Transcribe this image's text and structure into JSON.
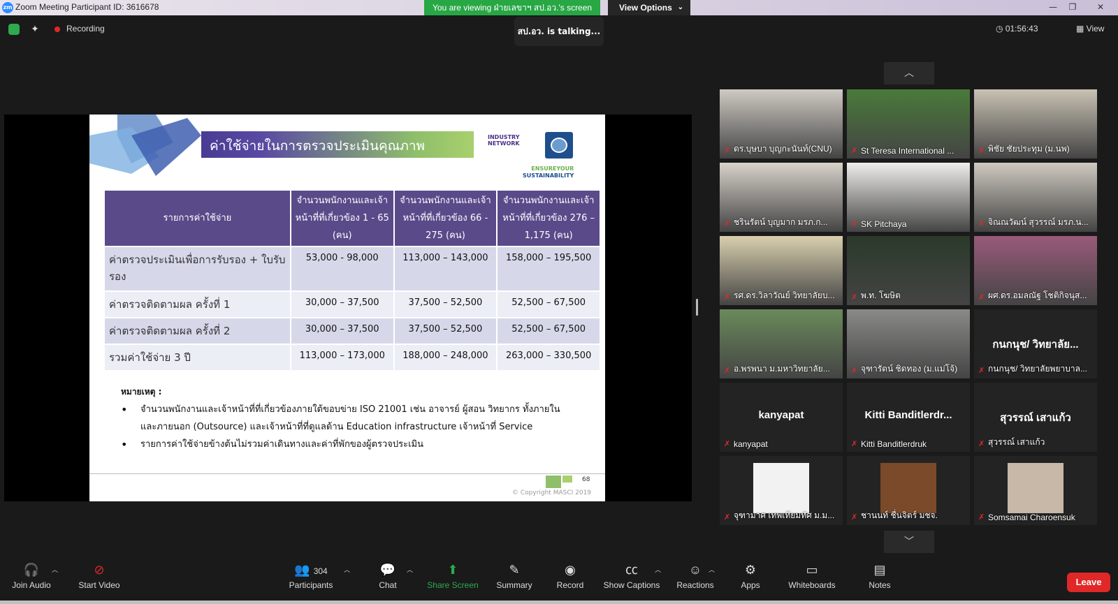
{
  "window": {
    "title": "Zoom Meeting Participant ID: 3616678",
    "viewing_banner": "You are viewing ฝ่ายเลขาฯ สป.อว.'s screen",
    "view_options": "View Options"
  },
  "topbar": {
    "recording": "Recording",
    "talking": "สป.อว. is talking...",
    "timer": "01:56:43",
    "view": "View"
  },
  "slide": {
    "title": "ค่าใช้จ่ายในการตรวจประเมินคุณภาพ",
    "logo_text": "INDUSTRY NETWORK",
    "ensure_1": "ENSURE",
    "ensure_2": "YOUR",
    "ensure_3": "SUSTAINABILITY",
    "table": {
      "headers": [
        "รายการค่าใช้จ่าย",
        "จำนวนพนักงานและเจ้าหน้าที่ที่เกี่ยวข้อง 1 - 65 (คน)",
        "จำนวนพนักงานและเจ้าหน้าที่ที่เกี่ยวข้อง 66 - 275 (คน)",
        "จำนวนพนักงานและเจ้าหน้าที่ที่เกี่ยวข้อง 276 – 1,175 (คน)"
      ],
      "rows": [
        [
          "ค่าตรวจประเมินเพื่อการรับรอง + ใบรับรอง",
          "53,000 - 98,000",
          "113,000 – 143,000",
          "158,000 – 195,500"
        ],
        [
          "ค่าตรวจติดตามผล ครั้งที่ 1",
          "30,000 – 37,500",
          "37,500 – 52,500",
          "52,500 – 67,500"
        ],
        [
          "ค่าตรวจติดตามผล ครั้งที่ 2",
          "30,000 – 37,500",
          "37,500 – 52,500",
          "52,500 – 67,500"
        ],
        [
          "รวมค่าใช้จ่าย 3 ปี",
          "113,000 – 173,000",
          "188,000 – 248,000",
          "263,000 – 330,500"
        ]
      ]
    },
    "notes_title": "หมายเหตุ :",
    "notes": [
      "จำนวนพนักงานและเจ้าหน้าที่ที่เกี่ยวข้องภายใต้ขอบข่าย ISO 21001 เช่น อาจารย์ ผู้สอน วิทยากร ทั้งภายในและภายนอก (Outsource) และเจ้าหน้าที่ที่ดูแลด้าน Education infrastructure เจ้าหน้าที่ Service",
      "รายการค่าใช้จ่ายข้างต้นไม่รวมค่าเดินทางและค่าที่พักของผู้ตรวจประเมิน"
    ],
    "page": "68",
    "copyright": "© Copyright MASCI 2019"
  },
  "participants": [
    {
      "name": "ดร.บุษบา บุญกะนันท์(CNU)",
      "big": ""
    },
    {
      "name": "St Teresa International ...",
      "big": ""
    },
    {
      "name": "พิชัย ชัยประทุม (ม.นพ)",
      "big": ""
    },
    {
      "name": "ชรินรัตน์ บุญมาก มรภ.ก...",
      "big": ""
    },
    {
      "name": "SK Pitchaya",
      "big": ""
    },
    {
      "name": "จิณณวัฒน์ สุวรรณ์ มรภ.น...",
      "big": ""
    },
    {
      "name": "รศ.ดร.วิลาวัณย์ วิทยาลัยบ...",
      "big": ""
    },
    {
      "name": "พ.ท. โฆษิต",
      "big": ""
    },
    {
      "name": "ผศ.ดร.อมลณัฐ โชติกิจนุส...",
      "big": ""
    },
    {
      "name": "อ.พรพนา ม.มหาวิทยาลัย...",
      "big": ""
    },
    {
      "name": "จุฑารัตน์ ชิดทอง (ม.แม่โจ้)",
      "big": ""
    },
    {
      "name": "กนกนุช/ วิทยาลัยพยาบาล...",
      "big": "กนกนุช/ วิทยาลัย..."
    },
    {
      "name": "kanyapat",
      "big": "kanyapat"
    },
    {
      "name": "Kitti Banditlerdruk",
      "big": "Kitti Banditlerdr..."
    },
    {
      "name": "สุวรรณ์ เสาแก้ว",
      "big": "สุวรรณ์ เสาแก้ว"
    },
    {
      "name": "จุฑามาศ เทพเทียมทัศ ม.ม...",
      "big": ""
    },
    {
      "name": "ชานนท์ ชื่นจิตร์ มชจ.",
      "big": ""
    },
    {
      "name": "Somsamai Charoensuk",
      "big": ""
    }
  ],
  "toolbar": {
    "join_audio": "Join Audio",
    "start_video": "Start Video",
    "participants_count": "304",
    "participants": "Participants",
    "chat": "Chat",
    "share_screen": "Share Screen",
    "summary": "Summary",
    "record": "Record",
    "show_captions": "Show Captions",
    "reactions": "Reactions",
    "apps": "Apps",
    "whiteboards": "Whiteboards",
    "notes": "Notes",
    "leave": "Leave"
  },
  "colors": {
    "accent_green": "#28a745",
    "leave_red": "#e02828",
    "table_header": "#5a4a8a"
  }
}
